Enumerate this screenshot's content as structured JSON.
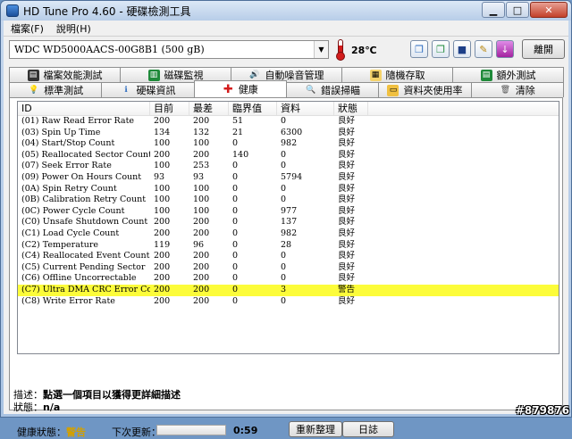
{
  "window": {
    "title": "HD Tune Pro 4.60 - 硬碟檢測工具"
  },
  "menu": [
    "檔案(F)",
    "說明(H)"
  ],
  "drive": {
    "selected": "WDC WD5000AACS-00G8B1 (500 gB)",
    "temperature": "28℃"
  },
  "toolbar": {
    "exit_label": "離開"
  },
  "tabs_row1": [
    {
      "label": "檔案效能測試"
    },
    {
      "label": "磁碟監視"
    },
    {
      "label": "自動噪音管理"
    },
    {
      "label": "隨機存取"
    },
    {
      "label": "額外測試"
    }
  ],
  "tabs_row2": [
    {
      "label": "標準測試"
    },
    {
      "label": "硬碟資訊"
    },
    {
      "label": "健康"
    },
    {
      "label": "錯誤掃瞄"
    },
    {
      "label": "資料夾使用率"
    },
    {
      "label": "清除"
    }
  ],
  "table": {
    "headers": [
      "ID",
      "目前",
      "最差",
      "臨界值",
      "資料",
      "狀態"
    ],
    "rows": [
      [
        "(01) Raw Read Error Rate",
        "200",
        "200",
        "51",
        "0",
        "良好"
      ],
      [
        "(03) Spin Up Time",
        "134",
        "132",
        "21",
        "6300",
        "良好"
      ],
      [
        "(04) Start/Stop Count",
        "100",
        "100",
        "0",
        "982",
        "良好"
      ],
      [
        "(05) Reallocated Sector Count",
        "200",
        "200",
        "140",
        "0",
        "良好"
      ],
      [
        "(07) Seek Error Rate",
        "100",
        "253",
        "0",
        "0",
        "良好"
      ],
      [
        "(09) Power On Hours Count",
        "93",
        "93",
        "0",
        "5794",
        "良好"
      ],
      [
        "(0A) Spin Retry Count",
        "100",
        "100",
        "0",
        "0",
        "良好"
      ],
      [
        "(0B) Calibration Retry Count",
        "100",
        "100",
        "0",
        "0",
        "良好"
      ],
      [
        "(0C) Power Cycle Count",
        "100",
        "100",
        "0",
        "977",
        "良好"
      ],
      [
        "(C0) Unsafe Shutdown Count",
        "200",
        "200",
        "0",
        "137",
        "良好"
      ],
      [
        "(C1) Load Cycle Count",
        "200",
        "200",
        "0",
        "982",
        "良好"
      ],
      [
        "(C2) Temperature",
        "119",
        "96",
        "0",
        "28",
        "良好"
      ],
      [
        "(C4) Reallocated Event Count",
        "200",
        "200",
        "0",
        "0",
        "良好"
      ],
      [
        "(C5) Current Pending Sector",
        "200",
        "200",
        "0",
        "0",
        "良好"
      ],
      [
        "(C6) Offline Uncorrectable",
        "200",
        "200",
        "0",
        "0",
        "良好"
      ],
      [
        "(C7) Ultra DMA CRC Error Count",
        "200",
        "200",
        "0",
        "3",
        "警告"
      ],
      [
        "(C8) Write Error Rate",
        "200",
        "200",
        "0",
        "0",
        "良好"
      ]
    ],
    "highlight_row": 15,
    "highlight_color": "#fcfc3a"
  },
  "description": {
    "label": "描述：",
    "text": "點選一個項目以獲得更詳細描述"
  },
  "status": {
    "label": "狀態：",
    "text": "n/a"
  },
  "footer": {
    "health_label": "健康狀態：",
    "health_value": "警告",
    "next_update_label": "下次更新：",
    "timer": "0:59",
    "refresh_label": "重新整理",
    "log_label": "日誌"
  },
  "watermark": "#879876"
}
